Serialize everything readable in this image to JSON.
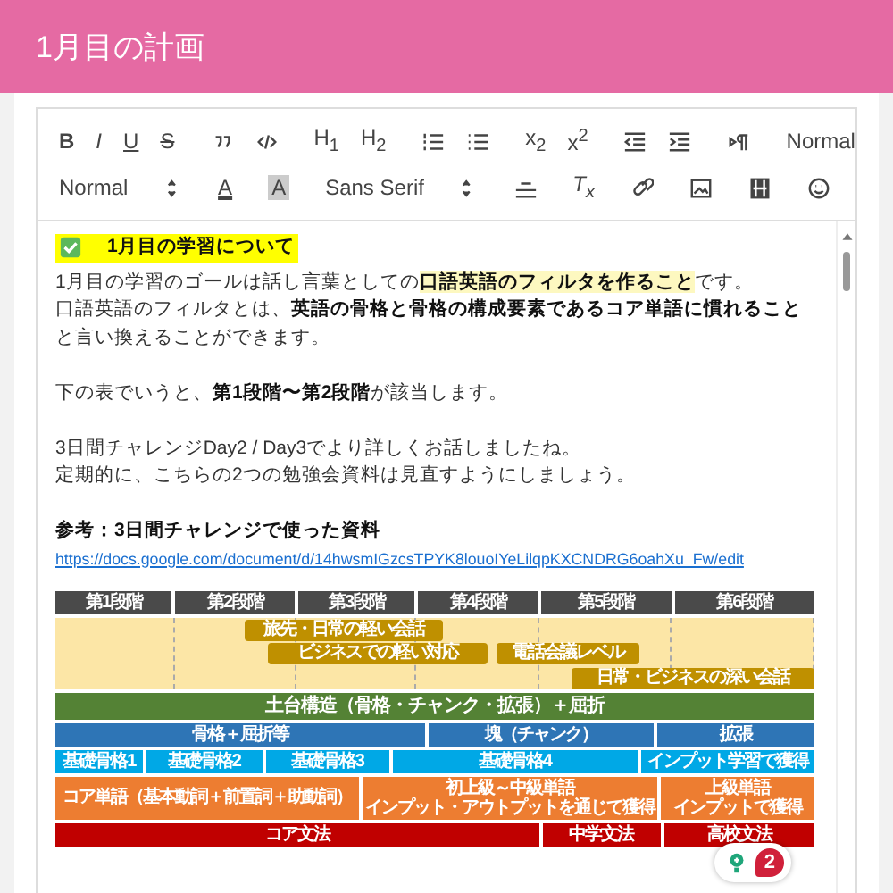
{
  "title": "1月目の計画",
  "toolbar": {
    "groups": [
      [
        {
          "kind": "bold",
          "label": "B"
        },
        {
          "kind": "italic",
          "label": "I"
        },
        {
          "kind": "underline",
          "label": "U"
        },
        {
          "kind": "strike",
          "label": "S"
        },
        {
          "kind": "quote"
        },
        {
          "kind": "code"
        },
        {
          "kind": "text",
          "label": "H$_{1}$"
        },
        {
          "kind": "text",
          "label": "H$_{2}$"
        },
        {
          "kind": "ordered-list"
        },
        {
          "kind": "bullet-list"
        },
        {
          "kind": "text",
          "label": "x$_{2}$"
        },
        {
          "kind": "text",
          "label": "x$^{2}$"
        },
        {
          "kind": "outdent"
        },
        {
          "kind": "indent"
        },
        {
          "kind": "direction"
        },
        {
          "kind": "select",
          "value": "Normal"
        }
      ],
      [
        {
          "kind": "select",
          "value": "Normal"
        },
        {
          "kind": "color",
          "label": "A"
        },
        {
          "kind": "background",
          "label": "A"
        },
        {
          "kind": "select",
          "value": "Sans Serif"
        },
        {
          "kind": "align"
        },
        {
          "kind": "clear",
          "label": "T$_{x}$"
        },
        {
          "kind": "link"
        },
        {
          "kind": "image"
        },
        {
          "kind": "video"
        },
        {
          "kind": "emoji"
        }
      ]
    ]
  },
  "paragraphs": [
    {
      "lines": [
        {
          "kind": "heading",
          "segments": [
            {
              "text": "1月目の学習について",
              "bold": true,
              "highlight": false
            }
          ]
        },
        {
          "kind": "text",
          "segments": [
            {
              "text": "1月目の学習のゴールは話し言葉としての",
              "bold": false,
              "highlight": false
            },
            {
              "text": "口語英語のフィルタを作ること",
              "bold": true,
              "highlight": true
            },
            {
              "text": "です。",
              "bold": false,
              "highlight": false
            }
          ]
        },
        {
          "kind": "text",
          "segments": [
            {
              "text": "口語英語のフィルタとは、",
              "bold": false,
              "highlight": false
            },
            {
              "text": "英語の骨格と骨格の構成要素であるコア単語に慣れること",
              "bold": true,
              "highlight": false
            },
            {
              "text": "と言い換えることができます。",
              "bold": false,
              "highlight": false
            }
          ]
        }
      ]
    },
    {
      "lines": [
        {
          "kind": "text",
          "segments": [
            {
              "text": "下の表でいうと、",
              "bold": false,
              "highlight": false
            },
            {
              "text": "第1段階〜第2段階",
              "bold": true,
              "highlight": false
            },
            {
              "text": "が該当します。",
              "bold": false,
              "highlight": false
            }
          ]
        }
      ]
    },
    {
      "lines": [
        {
          "kind": "text",
          "segments": [
            {
              "text": "3日間チャレンジDay2 / Day3でより詳しくお話しましたね。",
              "bold": false,
              "highlight": false
            }
          ]
        },
        {
          "kind": "text",
          "segments": [
            {
              "text": "定期的に、こちらの2つの勉強会資料は見直すようにしましょう。",
              "bold": false,
              "highlight": false
            }
          ]
        }
      ]
    },
    {
      "lines": [
        {
          "kind": "text",
          "segments": [
            {
              "text": "参考：3日間チャレンジで使った資料",
              "bold": true,
              "highlight": false
            }
          ]
        },
        {
          "kind": "link",
          "text": "https://docs.google.com/document/d/14hwsmIGzcsTPYK8louoIYeLilqpKXCNDRG6oahXu_Fw/edit"
        }
      ]
    }
  ],
  "diagram": {
    "stages": [
      "第1段階",
      "第2段階",
      "第3段階",
      "第4段階",
      "第5段階",
      "第6段階"
    ],
    "bars": [
      {
        "label": "旅先・日常の軽い会話"
      },
      {
        "label": "ビジネスでの軽い対応"
      },
      {
        "label": "電話会議レベル"
      },
      {
        "label": "日常・ビジネスの深い会話"
      }
    ],
    "foundation": "土台構造（骨格・チャンク・拡張）＋屈折",
    "bands": [
      {
        "kind": "framework",
        "blocks": [
          {
            "label": "骨格＋屈折等"
          },
          {
            "label": "塊（チャンク）"
          },
          {
            "label": "拡張"
          }
        ]
      },
      {
        "kind": "skeleton",
        "blocks": [
          {
            "label": "基礎骨格1"
          },
          {
            "label": "基礎骨格2"
          },
          {
            "label": "基礎骨格3"
          },
          {
            "label": "基礎骨格4"
          },
          {
            "label": "インプット学習で獲得"
          }
        ]
      },
      {
        "kind": "vocabulary",
        "blocks": [
          {
            "label": "コア単語（基本動詞＋前置詞＋助動詞）"
          },
          {
            "label": "初上級～中級単語",
            "note": "インプット・アウトプットを通じて獲得"
          },
          {
            "label": "上級単語",
            "note": "インプットで獲得"
          }
        ]
      },
      {
        "kind": "grammar",
        "blocks": [
          {
            "label": "コア文法"
          },
          {
            "label": "中学文法"
          },
          {
            "label": "高校文法"
          }
        ]
      }
    ]
  },
  "notification": {
    "count": "2"
  }
}
